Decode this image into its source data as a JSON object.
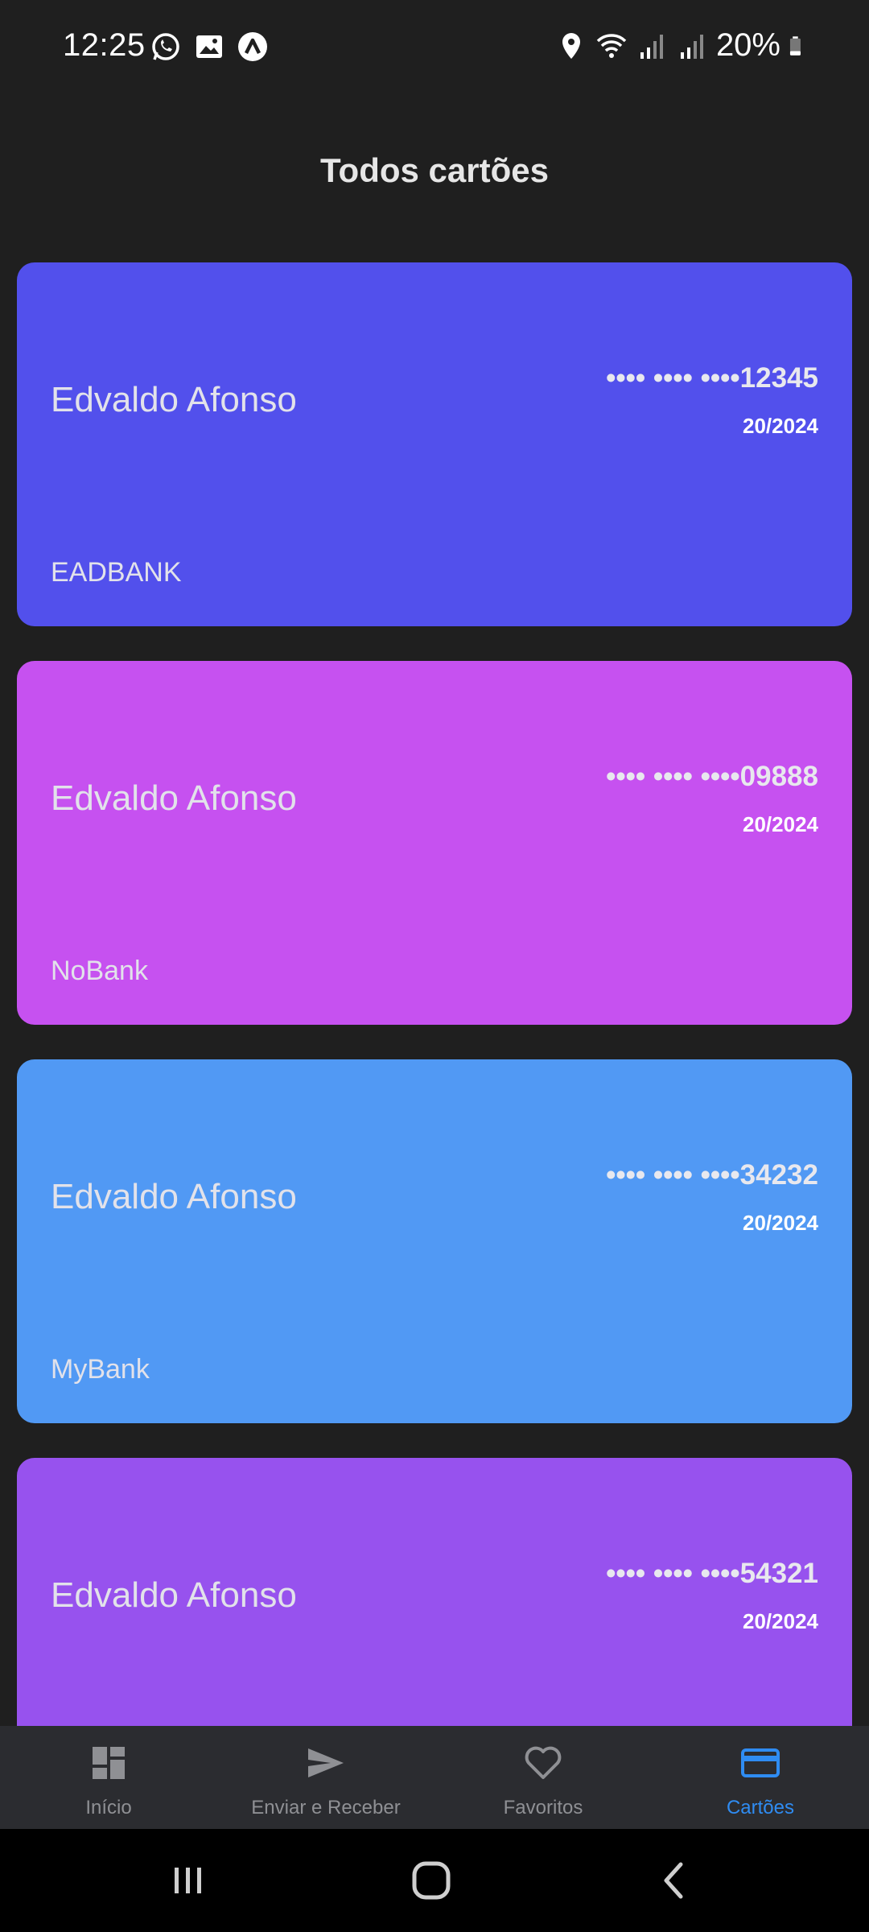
{
  "status_bar": {
    "time": "12:25",
    "battery": "20%",
    "left_icons": [
      "whatsapp-icon",
      "gallery-icon",
      "app-icon"
    ],
    "right_icons": [
      "location-icon",
      "wifi-icon",
      "signal-icon",
      "signal-icon",
      "battery-icon"
    ]
  },
  "page": {
    "title": "Todos cartões"
  },
  "cards": [
    {
      "holder": "Edvaldo Afonso",
      "number": "•••• •••• ••••12345",
      "expiry": "20/2024",
      "bank": "EADBANK",
      "color": "#5250ec"
    },
    {
      "holder": "Edvaldo Afonso",
      "number": "•••• •••• ••••09888",
      "expiry": "20/2024",
      "bank": "NoBank",
      "color": "#c651f0"
    },
    {
      "holder": "Edvaldo Afonso",
      "number": "•••• •••• ••••34232",
      "expiry": "20/2024",
      "bank": "MyBank",
      "color": "#5199f4"
    },
    {
      "holder": "Edvaldo Afonso",
      "number": "•••• •••• ••••54321",
      "expiry": "20/2024",
      "bank": "",
      "color": "#9752ee"
    }
  ],
  "bottom_nav": {
    "items": [
      {
        "label": "Início",
        "icon": "dashboard-icon",
        "active": false
      },
      {
        "label": "Enviar e Receber",
        "icon": "send-icon",
        "active": false
      },
      {
        "label": "Favoritos",
        "icon": "heart-icon",
        "active": false
      },
      {
        "label": "Cartões",
        "icon": "credit-card-icon",
        "active": true
      }
    ],
    "active_color": "#2f8cf2",
    "inactive_color": "#8f9094"
  }
}
